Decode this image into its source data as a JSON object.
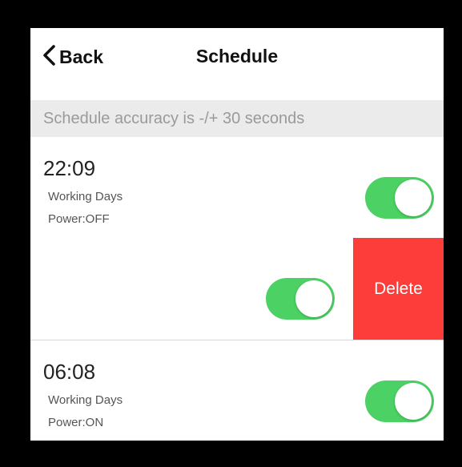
{
  "navbar": {
    "back_label": "Back",
    "title": "Schedule",
    "back_icon": "chevron-left-icon"
  },
  "notice": {
    "text": "Schedule accuracy is -/+ 30 seconds"
  },
  "schedules": [
    {
      "time": "22:09",
      "repeat": "Working Days",
      "power": "Power:OFF",
      "enabled": true
    },
    {
      "time": "",
      "repeat": "",
      "power": "",
      "enabled": true,
      "swiped": true
    },
    {
      "time": "06:08",
      "repeat": "Working Days",
      "power": "Power:ON",
      "enabled": true
    }
  ],
  "delete_action": {
    "label": "Delete",
    "color": "#fc3d39"
  },
  "colors": {
    "toggle_on": "#4cd264",
    "notice_bg": "#ebebeb"
  }
}
